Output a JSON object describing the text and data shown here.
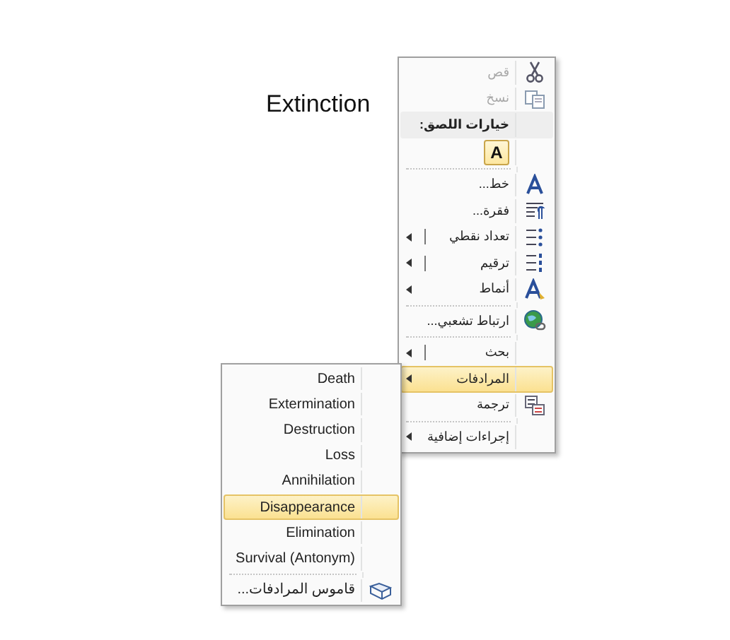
{
  "document": {
    "word": "Extinction"
  },
  "menu": {
    "items": [
      {
        "kind": "item",
        "label": "قص",
        "disabled": true,
        "submenu": false,
        "split": false,
        "selected": false
      },
      {
        "kind": "item",
        "label": "نسخ",
        "disabled": true,
        "submenu": false,
        "split": false,
        "selected": false
      },
      {
        "kind": "header",
        "label": "خيارات اللصق:"
      },
      {
        "kind": "paste",
        "label": "A"
      },
      {
        "kind": "separator"
      },
      {
        "kind": "item",
        "label": "خط...",
        "disabled": false,
        "submenu": false,
        "split": false,
        "selected": false
      },
      {
        "kind": "item",
        "label": "فقرة...",
        "disabled": false,
        "submenu": false,
        "split": false,
        "selected": false
      },
      {
        "kind": "item",
        "label": "تعداد نقطي",
        "disabled": false,
        "submenu": true,
        "split": true,
        "selected": false
      },
      {
        "kind": "item",
        "label": "ترقيم",
        "disabled": false,
        "submenu": true,
        "split": true,
        "selected": false
      },
      {
        "kind": "item",
        "label": "أنماط",
        "disabled": false,
        "submenu": true,
        "split": false,
        "selected": false
      },
      {
        "kind": "separator"
      },
      {
        "kind": "item",
        "label": "ارتباط تشعبي...",
        "disabled": false,
        "submenu": false,
        "split": false,
        "selected": false
      },
      {
        "kind": "separator"
      },
      {
        "kind": "item",
        "label": "بحث",
        "disabled": false,
        "submenu": true,
        "split": true,
        "selected": false
      },
      {
        "kind": "item",
        "label": "المرادفات",
        "disabled": false,
        "submenu": true,
        "split": false,
        "selected": true
      },
      {
        "kind": "item",
        "label": "ترجمة",
        "disabled": false,
        "submenu": false,
        "split": false,
        "selected": false
      },
      {
        "kind": "separator"
      },
      {
        "kind": "item",
        "label": "إجراءات إضافية",
        "disabled": false,
        "submenu": true,
        "split": false,
        "selected": false
      }
    ]
  },
  "submenu": {
    "items": [
      {
        "kind": "item",
        "label": "Death",
        "selected": false
      },
      {
        "kind": "item",
        "label": "Extermination",
        "selected": false
      },
      {
        "kind": "item",
        "label": "Destruction",
        "selected": false
      },
      {
        "kind": "item",
        "label": "Loss",
        "selected": false
      },
      {
        "kind": "item",
        "label": "Annihilation",
        "selected": false
      },
      {
        "kind": "item",
        "label": "Disappearance",
        "selected": true
      },
      {
        "kind": "item",
        "label": "Elimination",
        "selected": false
      },
      {
        "kind": "item",
        "label": "Survival (Antonym)",
        "selected": false
      },
      {
        "kind": "separator"
      },
      {
        "kind": "item",
        "label": "قاموس المرادفات...",
        "selected": false
      }
    ]
  }
}
